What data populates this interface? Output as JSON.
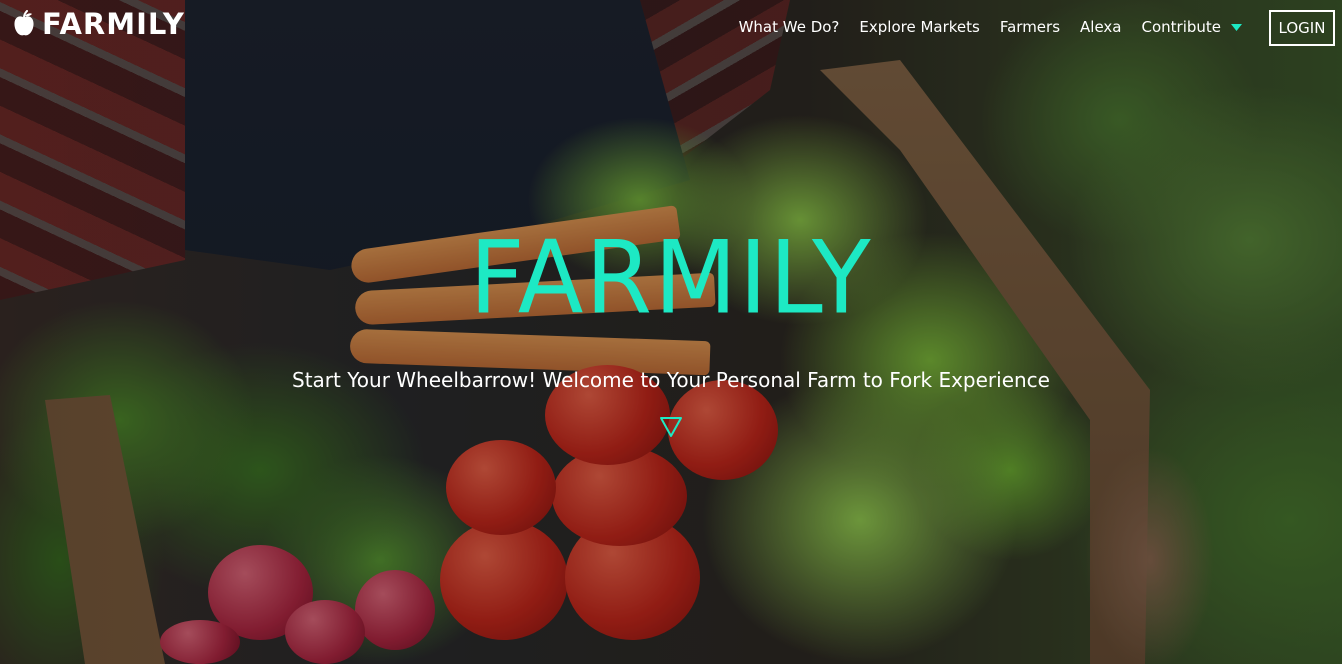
{
  "brand": {
    "name": "FARMILY",
    "icon": "apple-icon"
  },
  "nav": {
    "items": [
      {
        "label": "What We Do?"
      },
      {
        "label": "Explore Markets"
      },
      {
        "label": "Farmers"
      },
      {
        "label": "Alexa"
      },
      {
        "label": "Contribute",
        "has_dropdown": true
      }
    ],
    "login_label": "LOGIN"
  },
  "hero": {
    "title": "FARMILY",
    "subtitle": "Start Your Wheelbarrow! Welcome to Your Personal Farm to Fork Experience",
    "scroll_icon": "triangle-down-icon"
  },
  "colors": {
    "accent": "#1de9c4",
    "nav_text": "#ffffff"
  }
}
